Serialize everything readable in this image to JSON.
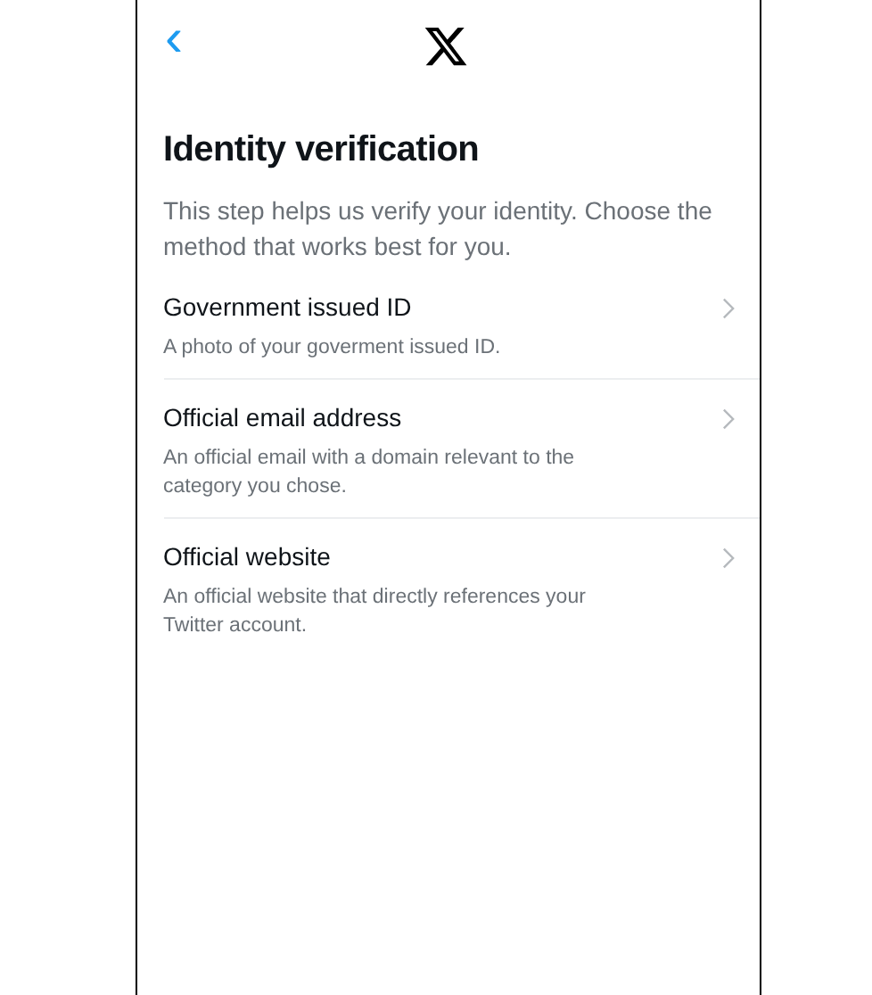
{
  "header": {
    "back": "‹"
  },
  "title": "Identity verification",
  "description": "This step helps us verify your identity. Choose the method that works best for you.",
  "options": [
    {
      "title": "Government issued ID",
      "description": "A photo of your goverment issued ID."
    },
    {
      "title": "Official email address",
      "description": "An official email with a domain relevant to the category you chose."
    },
    {
      "title": "Official website",
      "description": "An official website that directly references your Twitter account."
    }
  ]
}
